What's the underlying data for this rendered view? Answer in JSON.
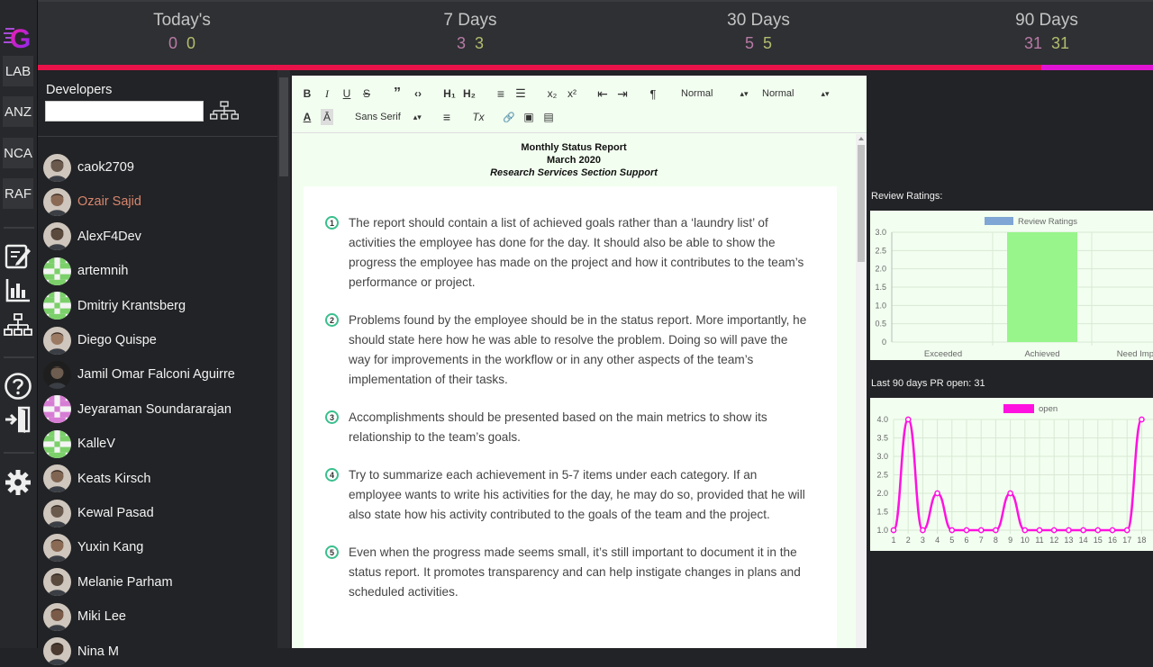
{
  "app": {
    "logo_letter": "G",
    "colors": {
      "accent": "#e9134a",
      "accent_tail": "#e214d4",
      "editor_bg": "#f2fff0",
      "chart_bar": "#98f58c",
      "chart_line": "#ff12e0"
    }
  },
  "rail": {
    "buttons": [
      "LAB",
      "ANZ",
      "NCA",
      "RAF"
    ],
    "icons": [
      "edit-icon",
      "bar-chart-icon",
      "org-chart-icon",
      "help-icon",
      "logout-icon",
      "gear-icon"
    ]
  },
  "stats": [
    {
      "label": "Today's",
      "a": "0",
      "b": "0"
    },
    {
      "label": "7 Days",
      "a": "3",
      "b": "3"
    },
    {
      "label": "30 Days",
      "a": "5",
      "b": "5"
    },
    {
      "label": "90 Days",
      "a": "31",
      "b": "31"
    }
  ],
  "developers": {
    "title": "Developers",
    "search_value": "",
    "items": [
      {
        "name": "caok2709",
        "active": false,
        "avatar": "photo"
      },
      {
        "name": "Ozair Sajid",
        "active": true,
        "avatar": "photo"
      },
      {
        "name": "AlexF4Dev",
        "active": false,
        "avatar": "photo"
      },
      {
        "name": "artemnih",
        "active": false,
        "avatar": "identicon-green"
      },
      {
        "name": "Dmitriy Krantsberg",
        "active": false,
        "avatar": "identicon-green"
      },
      {
        "name": "Diego Quispe",
        "active": false,
        "avatar": "photo"
      },
      {
        "name": "Jamil Omar Falconi Aguirre",
        "active": false,
        "avatar": "photo-dark"
      },
      {
        "name": "Jeyaraman Soundararajan",
        "active": false,
        "avatar": "identicon-pink"
      },
      {
        "name": "KalleV",
        "active": false,
        "avatar": "identicon-green"
      },
      {
        "name": "Keats Kirsch",
        "active": false,
        "avatar": "photo"
      },
      {
        "name": "Kewal Pasad",
        "active": false,
        "avatar": "photo"
      },
      {
        "name": "Yuxin Kang",
        "active": false,
        "avatar": "photo"
      },
      {
        "name": "Melanie Parham",
        "active": false,
        "avatar": "photo"
      },
      {
        "name": "Miki Lee",
        "active": false,
        "avatar": "photo"
      },
      {
        "name": "Nina M",
        "active": false,
        "avatar": "photo"
      }
    ]
  },
  "editor": {
    "toolbar": {
      "row1": [
        "B",
        "I",
        "U",
        "S",
        "”",
        "‹›",
        "H₁",
        "H₂",
        "≡",
        "☰",
        "x₂",
        "x²",
        "⇤",
        "⇥",
        "¶"
      ],
      "header_select": "Normal",
      "size_select": "Normal",
      "font_select": "Sans Serif",
      "row2": [
        "A",
        "Ā",
        "≡",
        "Tx",
        "🔗",
        "▣",
        "▤"
      ]
    },
    "doc": {
      "title": "Monthly Status Report",
      "date": "March 2020",
      "subtitle": "Research Services Section Support",
      "items": [
        "The report should contain a list of achieved goals rather than a ‘laundry list’ of activities the employee has done for the day. It should also be able to show the progress the employee has made on the project and how it contributes to the team’s performance or project.",
        "Problems found by the employee should be in the status report. More importantly, he should state here how he was able to resolve the problem. Doing so will pave the way for improvements in the workflow or in any other aspects of the team’s implementation of their tasks.",
        "Accomplishments should be presented based on the main metrics to show its relationship to the team’s goals.",
        "Try to summarize each achievement in 5-7 items under each category. If an employee wants to write his activities for the day, he may do so, provided that he will also state how his activity contributed to the goals of the team and the project.",
        "Even when the progress made seems small, it’s still important to document it in the status report. It promotes transparency and can help instigate changes in plans and scheduled activities."
      ]
    }
  },
  "charts": {
    "ratings_title": "Review Ratings:",
    "pr_title": "Last 90 days PR open: 31"
  },
  "chart_data": [
    {
      "type": "bar",
      "legend": "Review Ratings",
      "categories": [
        "Exceeded",
        "Achieved",
        "Need Improv"
      ],
      "values": [
        0,
        3,
        0
      ],
      "ylim": [
        0,
        3
      ],
      "yticks": [
        "0",
        "0.5",
        "1.0",
        "1.5",
        "2.0",
        "2.5",
        "3.0"
      ],
      "grid": true,
      "legend_position": "top"
    },
    {
      "type": "line",
      "legend": "open",
      "x": [
        1,
        2,
        3,
        4,
        5,
        6,
        7,
        8,
        9,
        10,
        11,
        12,
        13,
        14,
        15,
        16,
        17,
        18
      ],
      "values": [
        1,
        4,
        1,
        2,
        1,
        1,
        1,
        1,
        2,
        1,
        1,
        1,
        1,
        1,
        1,
        1,
        1,
        4
      ],
      "ylim": [
        1,
        4
      ],
      "yticks": [
        "1.0",
        "1.5",
        "2.0",
        "2.5",
        "3.0",
        "3.5",
        "4.0"
      ],
      "grid": true,
      "legend_position": "top"
    }
  ]
}
